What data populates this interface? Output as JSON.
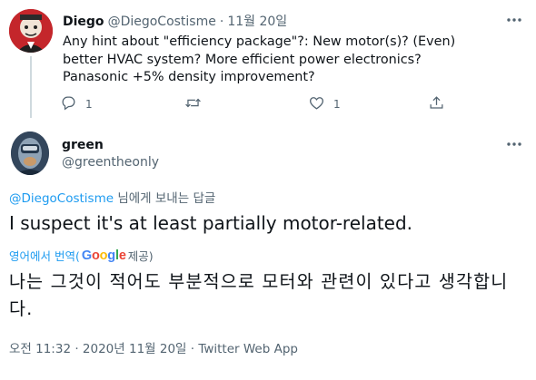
{
  "parent_tweet": {
    "display_name": "Diego",
    "handle": "@DiegoCostisme",
    "separator": "·",
    "time": "11월 20일",
    "text": "Any hint about \"efficiency package\"?: New motor(s)? (Even) better HVAC system? More efficient power electronics? Panasonic +5% density improvement?",
    "actions": {
      "reply_count": "1",
      "retweet_count": "",
      "like_count": "1"
    }
  },
  "main_tweet": {
    "display_name": "green",
    "handle": "@greentheonly",
    "replying_to": {
      "mention": "@DiegoCostisme",
      "suffix": " 님에게 보내는 답글"
    },
    "text": "I suspect it's at least partially motor-related.",
    "translate": {
      "prefix": "영어에서 번역(",
      "google_letters": [
        "G",
        "o",
        "o",
        "g",
        "l",
        "e"
      ],
      "suffix": " 제공)"
    },
    "translated_text": "나는 그것이 적어도 부분적으로 모터와 관련이 있다고 생각합니다.",
    "meta": "오전 11:32 · 2020년 11월 20일 · Twitter Web App"
  },
  "colors": {
    "link": "#1d9bf0",
    "secondary_text": "#536471",
    "primary_text": "#0f1419",
    "thread_line": "#cfd9de"
  },
  "icons": [
    "more-icon",
    "reply-icon",
    "retweet-icon",
    "like-icon",
    "share-icon"
  ]
}
